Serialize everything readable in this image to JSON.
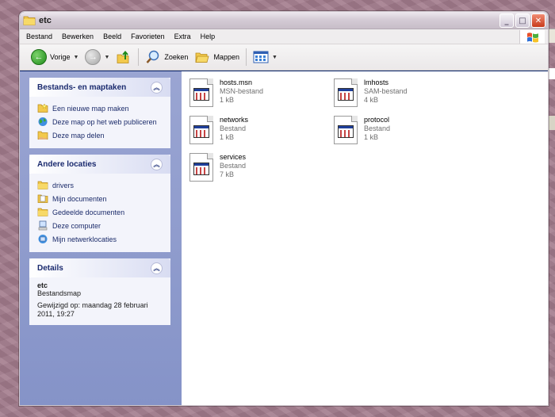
{
  "window": {
    "title": "etc"
  },
  "menu": [
    "Bestand",
    "Bewerken",
    "Beeld",
    "Favorieten",
    "Extra",
    "Help"
  ],
  "toolbar": {
    "back_label": "Vorige",
    "search_label": "Zoeken",
    "folders_label": "Mappen"
  },
  "panels": {
    "tasks": {
      "title": "Bestands- en maptaken",
      "items": [
        "Een nieuwe map maken",
        "Deze map op het web publiceren",
        "Deze map delen"
      ]
    },
    "other_places": {
      "title": "Andere locaties",
      "items": [
        "drivers",
        "Mijn documenten",
        "Gedeelde documenten",
        "Deze computer",
        "Mijn netwerklocaties"
      ]
    },
    "details": {
      "title": "Details",
      "name": "etc",
      "type": "Bestandsmap",
      "modified_line1": "Gewijzigd op: maandag 28 februari",
      "modified_line2": "2011, 19:27"
    }
  },
  "files": [
    {
      "name": "hosts.msn",
      "type": "MSN-bestand",
      "size": "1 kB"
    },
    {
      "name": "lmhosts",
      "type": "SAM-bestand",
      "size": "4 kB"
    },
    {
      "name": "networks",
      "type": "Bestand",
      "size": "1 kB"
    },
    {
      "name": "protocol",
      "type": "Bestand",
      "size": "1 kB"
    },
    {
      "name": "services",
      "type": "Bestand",
      "size": "7 kB"
    }
  ]
}
